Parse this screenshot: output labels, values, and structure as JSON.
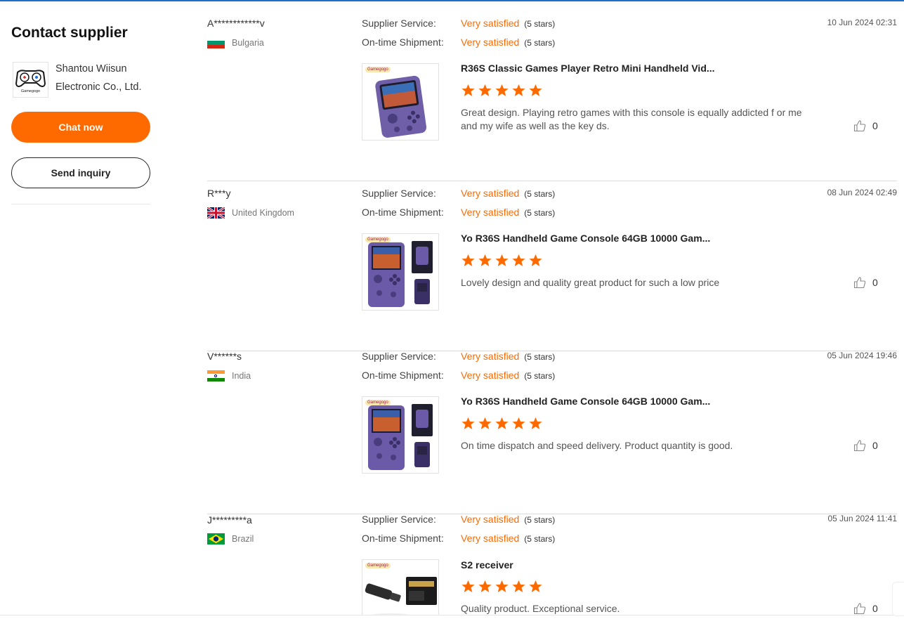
{
  "sidebar": {
    "title": "Contact supplier",
    "supplier_name_line1": "Shantou Wiisun",
    "supplier_name_line2": "Electronic Co., Ltd.",
    "logo_text": "Gamegogo",
    "chat_label": "Chat now",
    "inquiry_label": "Send inquiry"
  },
  "colors": {
    "accent": "#ff6a00",
    "topbar": "#1f6fc7"
  },
  "reviews": [
    {
      "user": "A************v",
      "country": "Bulgaria",
      "flag": "flag-bulgaria",
      "supplier_service_label": "Supplier Service:",
      "supplier_service_value": "Very satisfied",
      "supplier_service_stars": "(5 stars)",
      "shipment_label": "On-time Shipment:",
      "shipment_value": "Very satisfied",
      "shipment_stars": "(5 stars)",
      "date": "10 Jun 2024 02:31",
      "product_title": "R36S Classic Games Player Retro Mini Handheld Vid...",
      "product_tag": "Gamegogo",
      "rating": 5,
      "comment": "Great design. Playing retro games with this console is equally addicted f or me and my wife as well as the key ds.",
      "likes": "0"
    },
    {
      "user": "R***y",
      "country": "United Kingdom",
      "flag": "flag-uk",
      "supplier_service_label": "Supplier Service:",
      "supplier_service_value": "Very satisfied",
      "supplier_service_stars": "(5 stars)",
      "shipment_label": "On-time Shipment:",
      "shipment_value": "Very satisfied",
      "shipment_stars": "(5 stars)",
      "date": "08 Jun 2024 02:49",
      "product_title": "Yo R36S Handheld Game Console 64GB 10000 Gam...",
      "product_tag": "Gamegogo",
      "rating": 5,
      "comment": "Lovely design and quality great product for such a low price",
      "likes": "0"
    },
    {
      "user": "V******s",
      "country": "India",
      "flag": "flag-india",
      "supplier_service_label": "Supplier Service:",
      "supplier_service_value": "Very satisfied",
      "supplier_service_stars": "(5 stars)",
      "shipment_label": "On-time Shipment:",
      "shipment_value": "Very satisfied",
      "shipment_stars": "(5 stars)",
      "date": "05 Jun 2024 19:46",
      "product_title": "Yo R36S Handheld Game Console 64GB 10000 Gam...",
      "product_tag": "Gamegogo",
      "rating": 5,
      "comment": "On time dispatch and speed delivery. Product quantity is good.",
      "likes": "0"
    },
    {
      "user": "J*********a",
      "country": "Brazil",
      "flag": "flag-brazil",
      "supplier_service_label": "Supplier Service:",
      "supplier_service_value": "Very satisfied",
      "supplier_service_stars": "(5 stars)",
      "shipment_label": "On-time Shipment:",
      "shipment_value": "Very satisfied",
      "shipment_stars": "(5 stars)",
      "date": "05 Jun 2024 11:41",
      "product_title": "S2 receiver",
      "product_tag": "Gamegogo",
      "rating": 5,
      "comment": "Quality product. Exceptional service.",
      "likes": "0"
    }
  ]
}
